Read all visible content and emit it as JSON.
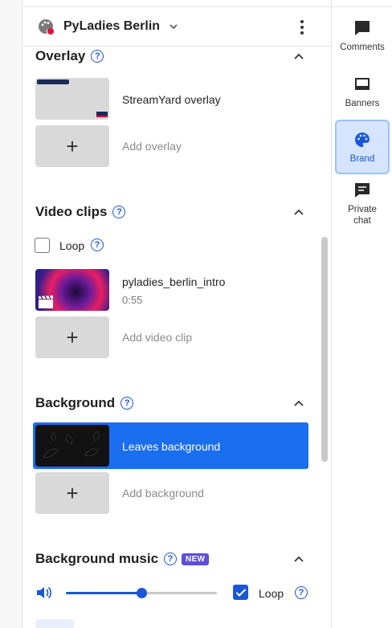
{
  "header": {
    "brand_name": "PyLadies Berlin"
  },
  "sections": {
    "overlay": {
      "title": "Overlay",
      "items": [
        {
          "label": "StreamYard overlay"
        }
      ],
      "add_label": "Add overlay"
    },
    "video_clips": {
      "title": "Video clips",
      "loop_label": "Loop",
      "loop_checked": false,
      "items": [
        {
          "label": "pyladies_berlin_intro",
          "duration": "0:55"
        }
      ],
      "add_label": "Add video clip"
    },
    "background": {
      "title": "Background",
      "items": [
        {
          "label": "Leaves background",
          "selected": true
        }
      ],
      "add_label": "Add background"
    },
    "background_music": {
      "title": "Background music",
      "badge": "NEW",
      "volume_fraction": 0.5,
      "loop_label": "Loop",
      "loop_checked": true
    }
  },
  "rail": {
    "items": [
      {
        "label": "Comments",
        "icon": "comment-icon"
      },
      {
        "label": "Banners",
        "icon": "banner-icon"
      },
      {
        "label": "Brand",
        "icon": "palette-icon",
        "active": true
      },
      {
        "label": "Private chat",
        "icon": "private-chat-icon"
      }
    ]
  },
  "colors": {
    "accent": "#1a56d6",
    "selected_bg": "#1a6ef0",
    "badge": "#5b4fd6",
    "active_rail_bg": "#d6e5ff"
  }
}
